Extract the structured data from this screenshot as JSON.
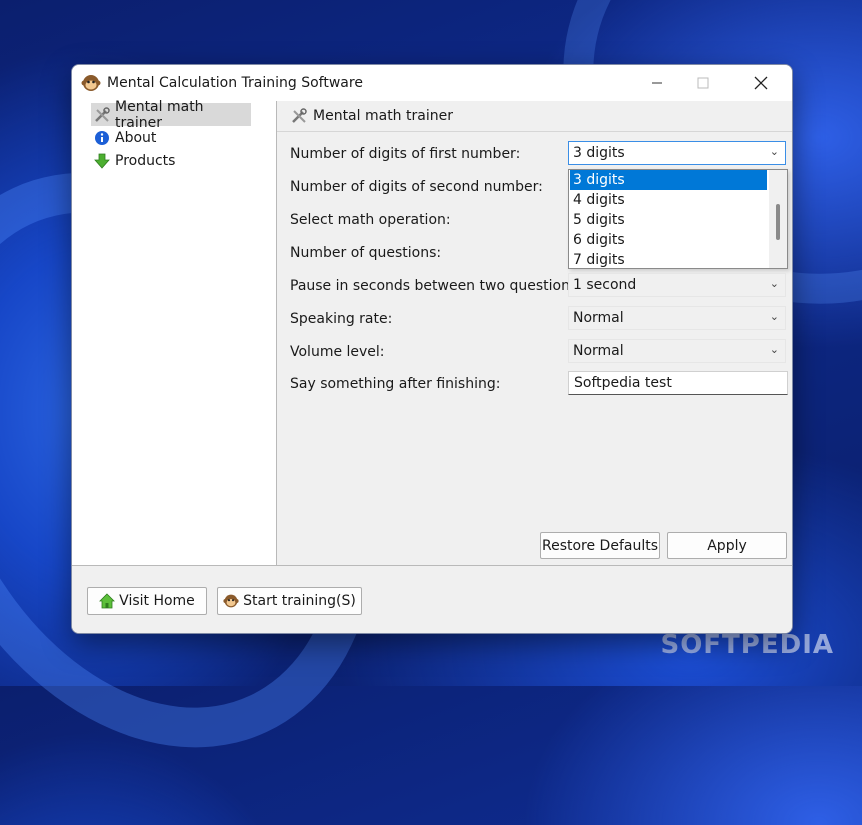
{
  "window": {
    "title": "Mental Calculation Training Software"
  },
  "sidebar": {
    "items": [
      {
        "label": "Mental math trainer",
        "icon": "tools-icon",
        "selected": true
      },
      {
        "label": "About",
        "icon": "info-icon"
      },
      {
        "label": "Products",
        "icon": "download-arrow-icon"
      }
    ]
  },
  "panel": {
    "header": "Mental math trainer",
    "fields": [
      {
        "label": "Number of digits of first number:",
        "value": "3 digits"
      },
      {
        "label": "Number of digits of second number:"
      },
      {
        "label": "Select math operation:"
      },
      {
        "label": "Number of questions:"
      },
      {
        "label": "Pause in seconds between two questions:",
        "value": "1 second"
      },
      {
        "label": "Speaking rate:",
        "value": "Normal"
      },
      {
        "label": "Volume level:",
        "value": "Normal"
      },
      {
        "label": "Say something after finishing:",
        "value": "Softpedia test"
      }
    ],
    "dropdown_options": [
      "3 digits",
      "4 digits",
      "5 digits",
      "6 digits",
      "7 digits"
    ],
    "restore_label": "Restore Defaults",
    "apply_label": "Apply"
  },
  "footer": {
    "visit_home_label": "Visit Home",
    "start_training_label": "Start training(S)"
  },
  "watermark": "SOFTPEDIA"
}
